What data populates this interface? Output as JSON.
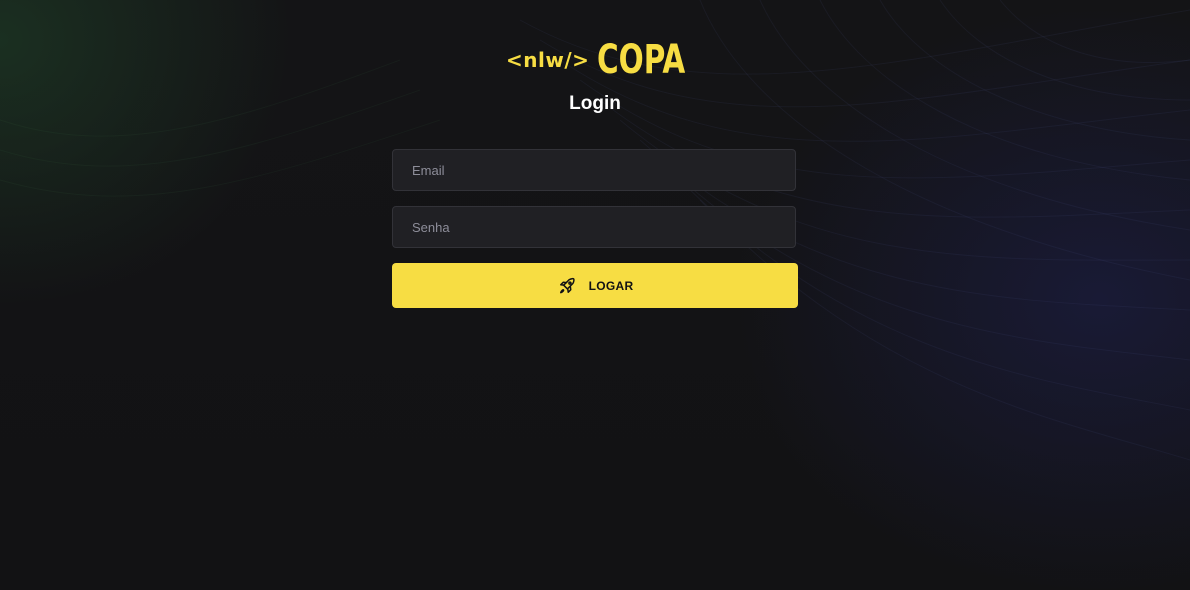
{
  "brand": {
    "code_tag": "<nlw/>",
    "name": "COPA",
    "accent_color": "#F7DD43"
  },
  "page": {
    "title": "Login"
  },
  "form": {
    "email_placeholder": "Email",
    "email_value": "",
    "password_placeholder": "Senha",
    "password_value": "",
    "submit_label": "LOGAR",
    "submit_icon": "rocket-icon"
  }
}
